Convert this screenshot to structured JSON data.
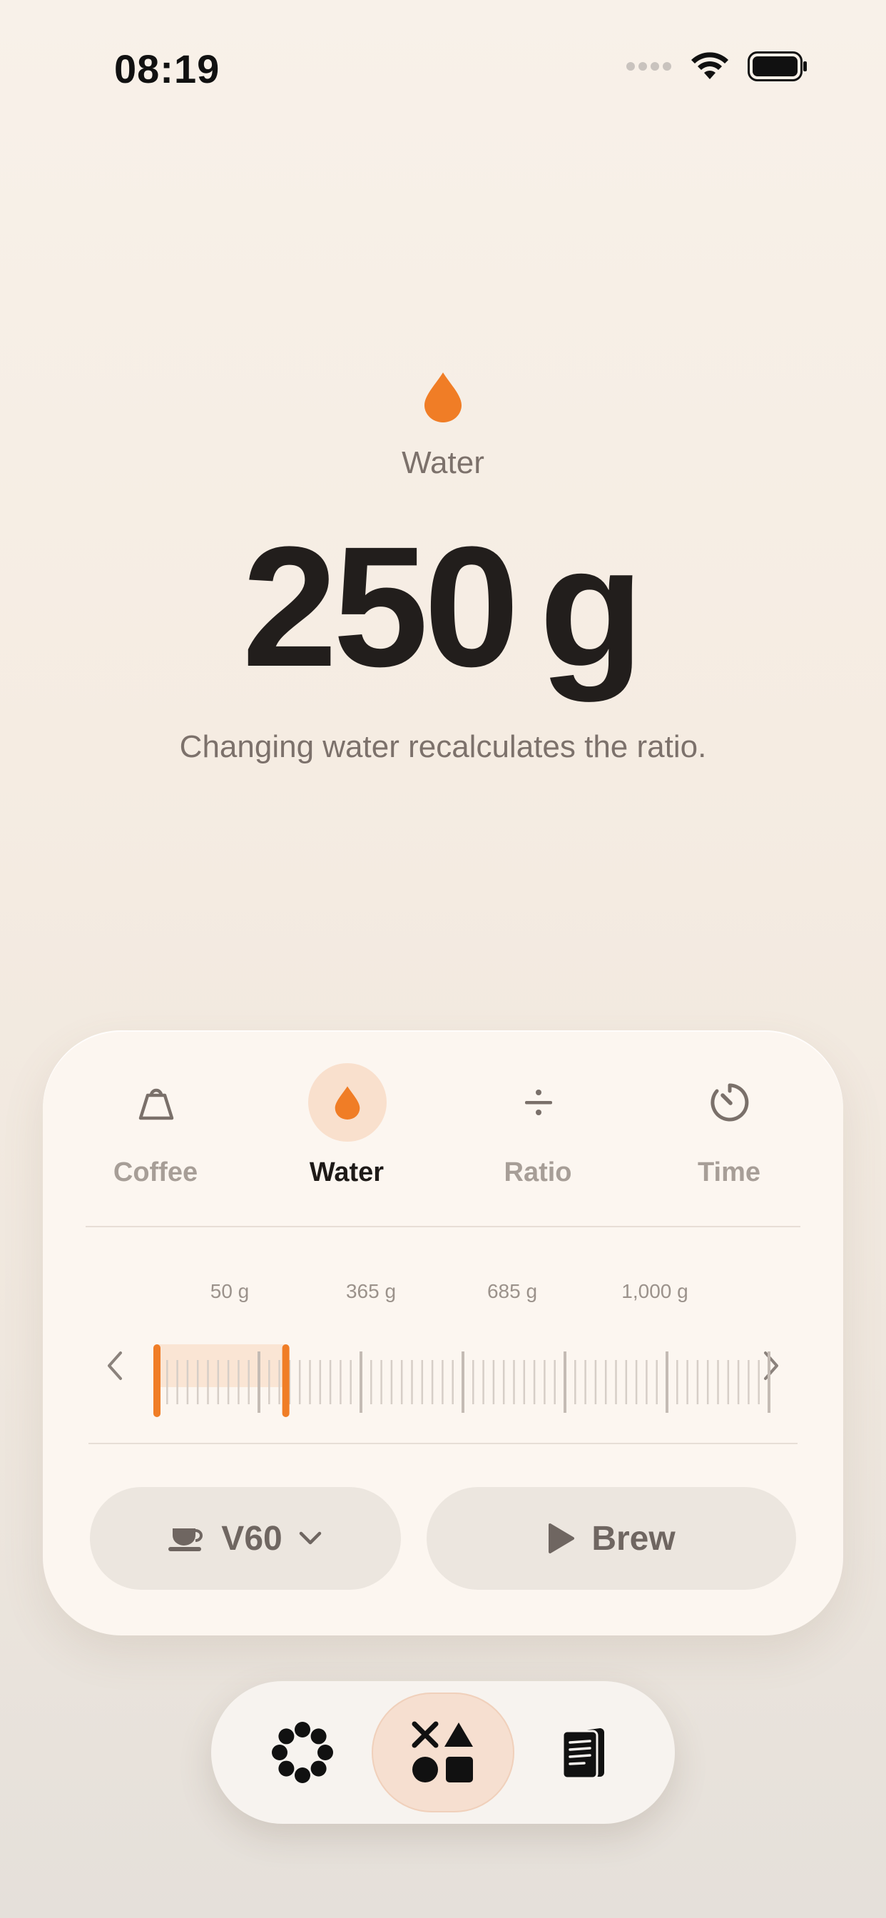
{
  "status_bar": {
    "time": "08:19",
    "icons": [
      "cellular-dots-icon",
      "wifi-icon",
      "battery-icon"
    ]
  },
  "hero": {
    "icon": "water-drop-icon",
    "label": "Water",
    "value": "250",
    "unit": "g",
    "hint": "Changing water recalculates the ratio."
  },
  "tabs": [
    {
      "label": "Coffee",
      "icon": "kettlebell-icon",
      "active": false
    },
    {
      "label": "Water",
      "icon": "water-drop-icon",
      "active": true
    },
    {
      "label": "Ratio",
      "icon": "divide-icon",
      "active": false
    },
    {
      "label": "Time",
      "icon": "timer-icon",
      "active": false
    }
  ],
  "ruler": {
    "labels": [
      "50 g",
      "365 g",
      "685 g",
      "1,000 g"
    ],
    "min": 50,
    "max": 1000,
    "selected_value": 250
  },
  "actions": {
    "method_label": "V60",
    "method_icon": "cup-icon",
    "brew_label": "Brew",
    "brew_icon": "play-icon"
  },
  "nav": {
    "items": [
      "flower-icon",
      "shapes-icon",
      "notes-icon"
    ],
    "active_index": 1
  },
  "colors": {
    "accent": "#f07d26",
    "text_dark": "#221e1c",
    "text_muted": "#7c716b"
  }
}
